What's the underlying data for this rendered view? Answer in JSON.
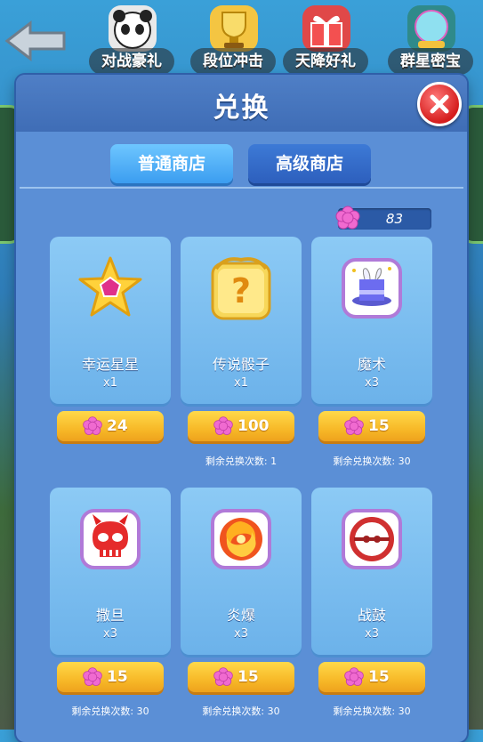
{
  "top_tabs": [
    {
      "label": "对战豪礼",
      "icon": "panda-icon"
    },
    {
      "label": "段位冲击",
      "icon": "trophy-icon"
    },
    {
      "label": "天降好礼",
      "icon": "gift-icon"
    },
    {
      "label": "群星密宝",
      "icon": "orb-icon"
    }
  ],
  "dialog": {
    "title": "兑换",
    "close_icon": "close-icon"
  },
  "shop_tabs": {
    "normal": "普通商店",
    "advanced": "高级商店",
    "active": "普通商店"
  },
  "currency": {
    "value": "83",
    "icon": "pink-gem-icon"
  },
  "items": [
    {
      "name": "幸运星星",
      "qty": "x1",
      "price": "24",
      "remain": ""
    },
    {
      "name": "传说骰子",
      "qty": "x1",
      "price": "100",
      "remain": "剩余兑换次数: 1"
    },
    {
      "name": "魔术",
      "qty": "x3",
      "price": "15",
      "remain": "剩余兑换次数: 30"
    },
    {
      "name": "撒旦",
      "qty": "x3",
      "price": "15",
      "remain": "剩余兑换次数: 30"
    },
    {
      "name": "炎爆",
      "qty": "x3",
      "price": "15",
      "remain": "剩余兑换次数: 30"
    },
    {
      "name": "战鼓",
      "qty": "x3",
      "price": "15",
      "remain": "剩余兑换次数: 30"
    }
  ],
  "colors": {
    "dialog_bg": "#5b8fd6",
    "card_bg": "#8ccaf5",
    "buy_button": "#f7b928",
    "close_button": "#d51d1d",
    "gem": "#f06ad0"
  }
}
